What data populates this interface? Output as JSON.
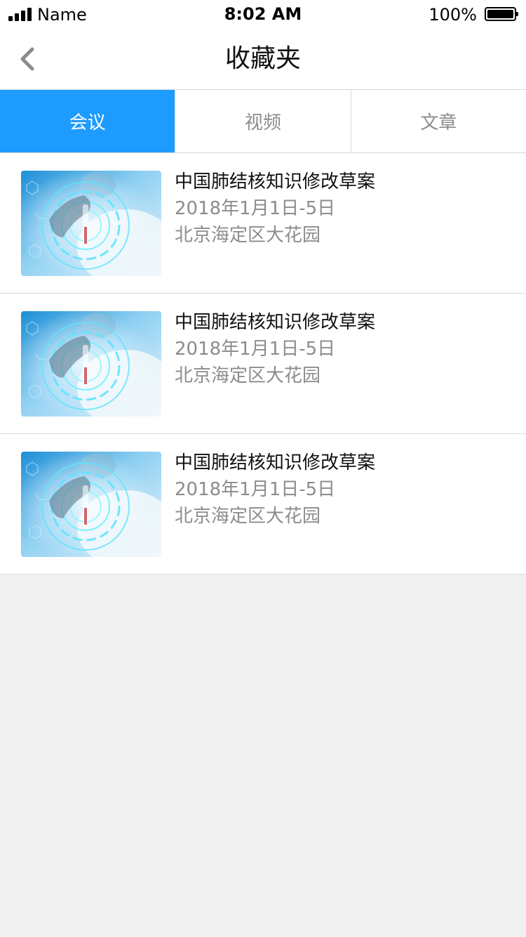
{
  "status_bar": {
    "carrier": "Name",
    "time": "8:02 AM",
    "battery": "100%"
  },
  "nav": {
    "title": "收藏夹",
    "back_icon": "chevron-left-icon"
  },
  "tabs": [
    {
      "label": "会议",
      "active": true
    },
    {
      "label": "视频",
      "active": false
    },
    {
      "label": "文章",
      "active": false
    }
  ],
  "items": [
    {
      "title": "中国肺结核知识修改草案",
      "date": "2018年1月1日-5日",
      "location": "北京海定区大花园"
    },
    {
      "title": "中国肺结核知识修改草案",
      "date": "2018年1月1日-5日",
      "location": "北京海定区大花园"
    },
    {
      "title": "中国肺结核知识修改草案",
      "date": "2018年1月1日-5日",
      "location": "北京海定区大花园"
    }
  ],
  "colors": {
    "accent": "#1e9bff",
    "background": "#f1f1f1",
    "divider": "#d9d9d9",
    "secondary_text": "#8c8c8c"
  }
}
